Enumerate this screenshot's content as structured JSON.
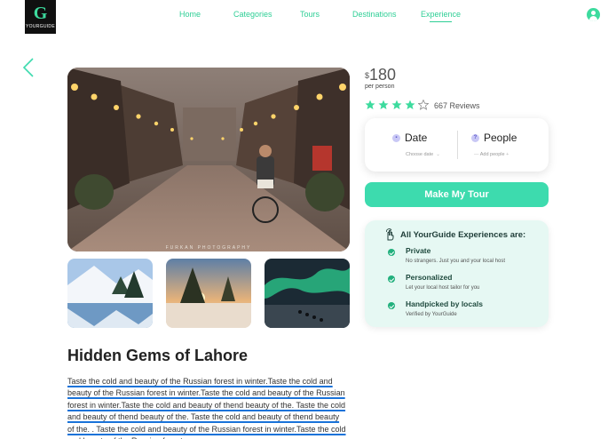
{
  "header": {
    "logo_letter": "G",
    "logo_text": "YOURGUIDE",
    "nav": [
      {
        "label": "Home"
      },
      {
        "label": "Categories"
      },
      {
        "label": "Tours"
      },
      {
        "label": "Destinations"
      },
      {
        "label": "Experience",
        "active": true
      }
    ]
  },
  "gallery": {
    "main_photo_watermark": "FURKAN PHOTOGRAPHY",
    "thumbnails": [
      "snowy-lake",
      "winter-sunset-forest",
      "aurora-dog-sled"
    ]
  },
  "tour": {
    "title": "Hidden Gems of Lahore",
    "description": "Taste the cold and beauty of the Russian forest in winter.Taste the cold and beauty of the Russian forest in winter.Taste the cold and beauty of the Russian forest in winter.Taste the cold and beauty of thend beauty of the. Taste the cold and beauty of thend beauty of the. Taste the cold and beauty of thend beauty of the. . Taste the cold and beauty of the Russian forest in winter.Taste the cold and beauty of the Russian forest"
  },
  "pricing": {
    "currency": "$",
    "amount": "180",
    "per": "per person",
    "rating": 4,
    "rating_max": 5,
    "reviews": "667 Reviews"
  },
  "booking": {
    "date_label": "Date",
    "date_sub": "Choose date",
    "people_label": "People",
    "people_sub": "Add people",
    "people_minus": "—",
    "people_plus": "+",
    "cta": "Make My Tour"
  },
  "experiences": {
    "heading": "All YourGuide Experiences are:",
    "items": [
      {
        "title": "Private",
        "subtitle": "No strangers. Just you and your local host"
      },
      {
        "title": "Personalized",
        "subtitle": "Let your local host tailor for you"
      },
      {
        "title": "Handpicked by locals",
        "subtitle": "Verified by YourGuide"
      }
    ]
  },
  "colors": {
    "accent": "#3ddbae",
    "nav_text": "#2fcf96",
    "panel_bg": "#e6f8f3",
    "star": "#3ddb9e",
    "underline": "#1a73d9"
  }
}
